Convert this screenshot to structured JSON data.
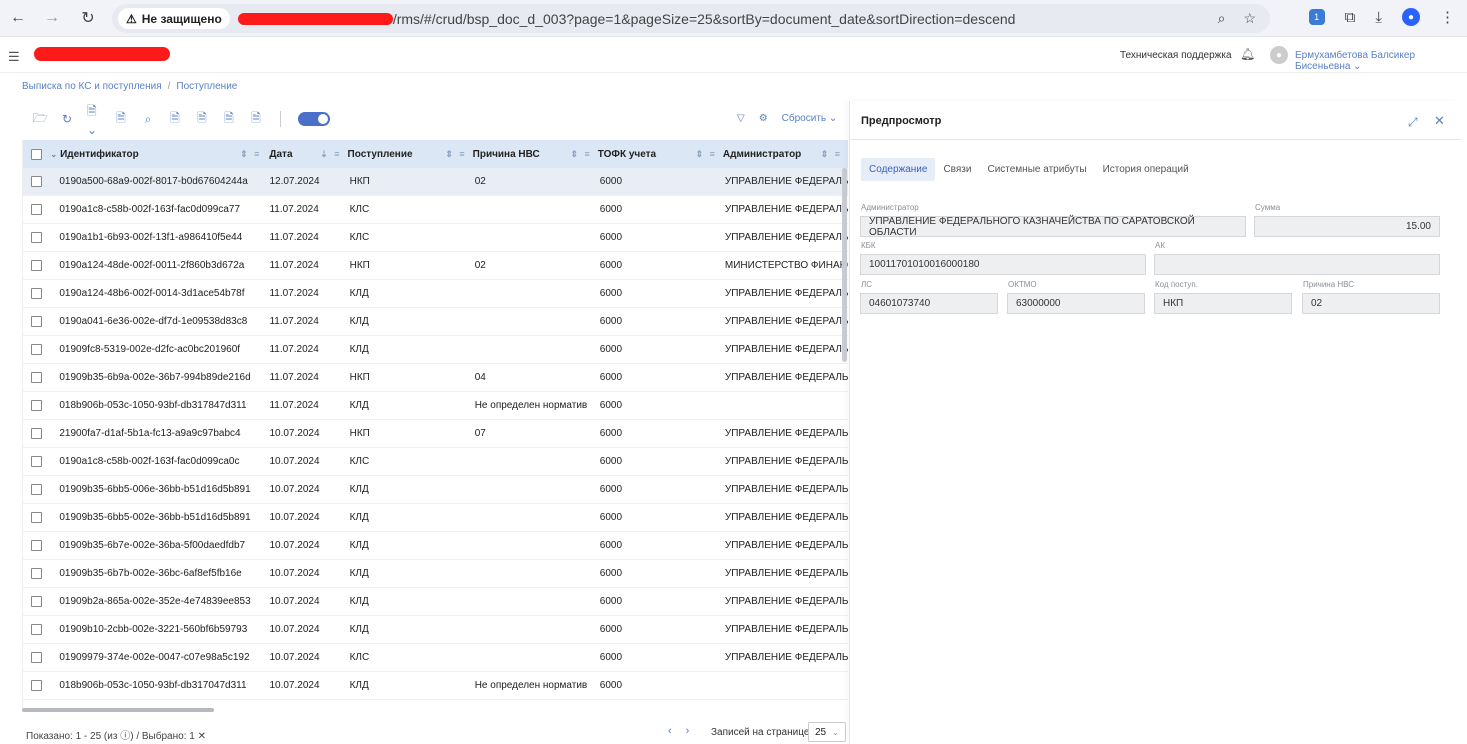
{
  "browser": {
    "security_label": "Не защищено",
    "url": "/rms/#/crud/bsp_doc_d_003?page=1&pageSize=25&sortBy=document_date&sortDirection=descend"
  },
  "header": {
    "support": "Техническая поддержка",
    "user_name": "Ермухамбетова Балсикер Бисеньевна"
  },
  "breadcrumb": {
    "parent": "Выписка по КС и поступления",
    "current": "Поступление"
  },
  "toolbar": {
    "reset_label": "Сбросить"
  },
  "table": {
    "columns": [
      "Идентификатор",
      "Дата",
      "Поступление",
      "Причина НВС",
      "ТОФК учета",
      "Администратор"
    ],
    "rows": [
      [
        "0190a500-68a9-002f-8017-b0d67604244a",
        "12.07.2024",
        "НКП",
        "02",
        "6000",
        "УПРАВЛЕНИЕ ФЕДЕРАЛЬ..."
      ],
      [
        "0190a1c8-c58b-002f-163f-fac0d099ca77",
        "11.07.2024",
        "КЛС",
        "",
        "6000",
        "УПРАВЛЕНИЕ ФЕДЕРАЛЬ..."
      ],
      [
        "0190a1b1-6b93-002f-13f1-a986410f5e44",
        "11.07.2024",
        "КЛС",
        "",
        "6000",
        "УПРАВЛЕНИЕ ФЕДЕРАЛЬ..."
      ],
      [
        "0190a124-48de-002f-0011-2f860b3d672a",
        "11.07.2024",
        "НКП",
        "02",
        "6000",
        "МИНИСТЕРСТВО ФИНАНС..."
      ],
      [
        "0190a124-48b6-002f-0014-3d1ace54b78f",
        "11.07.2024",
        "КЛД",
        "",
        "6000",
        "УПРАВЛЕНИЕ ФЕДЕРАЛЬ..."
      ],
      [
        "0190a041-6e36-002e-df7d-1e09538d83c8",
        "11.07.2024",
        "КЛД",
        "",
        "6000",
        "УПРАВЛЕНИЕ ФЕДЕРАЛЬ..."
      ],
      [
        "01909fc8-5319-002e-d2fc-ac0bc201960f",
        "11.07.2024",
        "КЛД",
        "",
        "6000",
        "УПРАВЛЕНИЕ ФЕДЕРАЛЬ..."
      ],
      [
        "01909b35-6b9a-002e-36b7-994b89de216d",
        "11.07.2024",
        "НКП",
        "04",
        "6000",
        "УПРАВЛЕНИЕ ФЕДЕРАЛЬ..."
      ],
      [
        "018b906b-053c-1050-93bf-db317847d311",
        "11.07.2024",
        "КЛД",
        "Не определен норматив",
        "6000",
        ""
      ],
      [
        "21900fa7-d1af-5b1a-fc13-a9a9c97babc4",
        "10.07.2024",
        "НКП",
        "07",
        "6000",
        "УПРАВЛЕНИЕ ФЕДЕРАЛЬ..."
      ],
      [
        "0190a1c8-c58b-002f-163f-fac0d099ca0c",
        "10.07.2024",
        "КЛС",
        "",
        "6000",
        "УПРАВЛЕНИЕ ФЕДЕРАЛЬ..."
      ],
      [
        "01909b35-6bb5-006e-36bb-b51d16d5b891",
        "10.07.2024",
        "КЛД",
        "",
        "6000",
        "УПРАВЛЕНИЕ ФЕДЕРАЛЬ..."
      ],
      [
        "01909b35-6bb5-002e-36bb-b51d16d5b891",
        "10.07.2024",
        "КЛД",
        "",
        "6000",
        "УПРАВЛЕНИЕ ФЕДЕРАЛЬ..."
      ],
      [
        "01909b35-6b7e-002e-36ba-5f00daedfdb7",
        "10.07.2024",
        "КЛД",
        "",
        "6000",
        "УПРАВЛЕНИЕ ФЕДЕРАЛЬ..."
      ],
      [
        "01909b35-6b7b-002e-36bc-6af8ef5fb16e",
        "10.07.2024",
        "КЛД",
        "",
        "6000",
        "УПРАВЛЕНИЕ ФЕДЕРАЛЬ..."
      ],
      [
        "01909b2a-865a-002e-352e-4e74839ee853",
        "10.07.2024",
        "КЛД",
        "",
        "6000",
        "УПРАВЛЕНИЕ ФЕДЕРАЛЬ..."
      ],
      [
        "01909b10-2cbb-002e-3221-560bf6b59793",
        "10.07.2024",
        "КЛД",
        "",
        "6000",
        "УПРАВЛЕНИЕ ФЕДЕРАЛЬ..."
      ],
      [
        "01909979-374e-002e-0047-c07e98a5c192",
        "10.07.2024",
        "КЛС",
        "",
        "6000",
        "УПРАВЛЕНИЕ ФЕДЕРАЛЬ..."
      ],
      [
        "018b906b-053c-1050-93bf-db317047d311",
        "10.07.2024",
        "КЛД",
        "Не определен норматив",
        "6000",
        ""
      ]
    ]
  },
  "footer": {
    "shown": "Показано: 1 - 25 (из ⓘ) / Выбрано: 1",
    "per_page_label": "Записей на странице",
    "per_page_value": "25"
  },
  "preview": {
    "title": "Предпросмотр",
    "tabs": [
      "Содержание",
      "Связи",
      "Системные атрибуты",
      "История операций"
    ],
    "fields": {
      "admin_label": "Администратор",
      "admin_value": "УПРАВЛЕНИЕ ФЕДЕРАЛЬНОГО КАЗНАЧЕЙСТВА ПО САРАТОВСКОЙ ОБЛАСТИ",
      "sum_label": "Сумма",
      "sum_value": "15.00",
      "kbk_label": "КБК",
      "kbk_value": "10011701010016000180",
      "ak_label": "АК",
      "ak_value": "",
      "ls_label": "ЛС",
      "ls_value": "04601073740",
      "oktmo_label": "ОКТМО",
      "oktmo_value": "63000000",
      "kod_label": "Код поступ.",
      "kod_value": "НКП",
      "reason_label": "Причина НВС",
      "reason_value": "02"
    }
  }
}
